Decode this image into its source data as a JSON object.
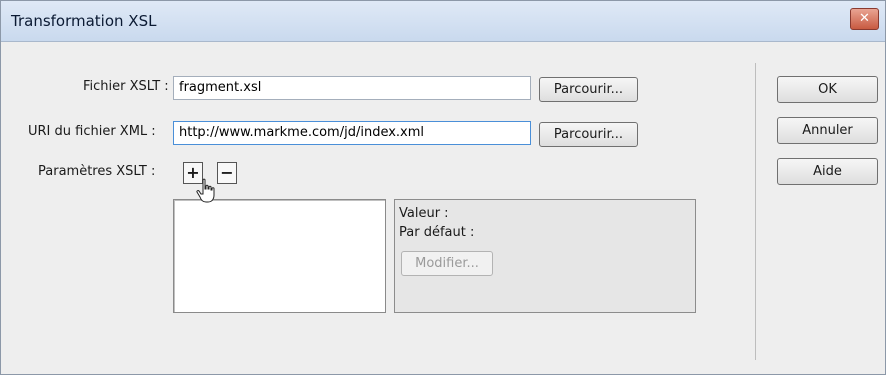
{
  "window": {
    "title": "Transformation XSL",
    "close_label": "✕"
  },
  "form": {
    "xslt_file": {
      "label": "Fichier XSLT :",
      "value": "fragment.xsl",
      "browse_label": "Parcourir..."
    },
    "xml_uri": {
      "label": "URI du fichier XML :",
      "value": "http://www.markme.com/jd/index.xml",
      "browse_label": "Parcourir..."
    },
    "params": {
      "label": "Paramètres XSLT :",
      "add_label": "+",
      "remove_label": "−",
      "value_label": "Valeur :",
      "default_label": "Par défaut :",
      "modify_label": "Modifier..."
    }
  },
  "actions": {
    "ok_label": "OK",
    "cancel_label": "Annuler",
    "help_label": "Aide"
  },
  "icons": {
    "close": "close-icon",
    "add": "plus-icon",
    "remove": "minus-icon",
    "cursor": "hand-cursor-icon"
  }
}
